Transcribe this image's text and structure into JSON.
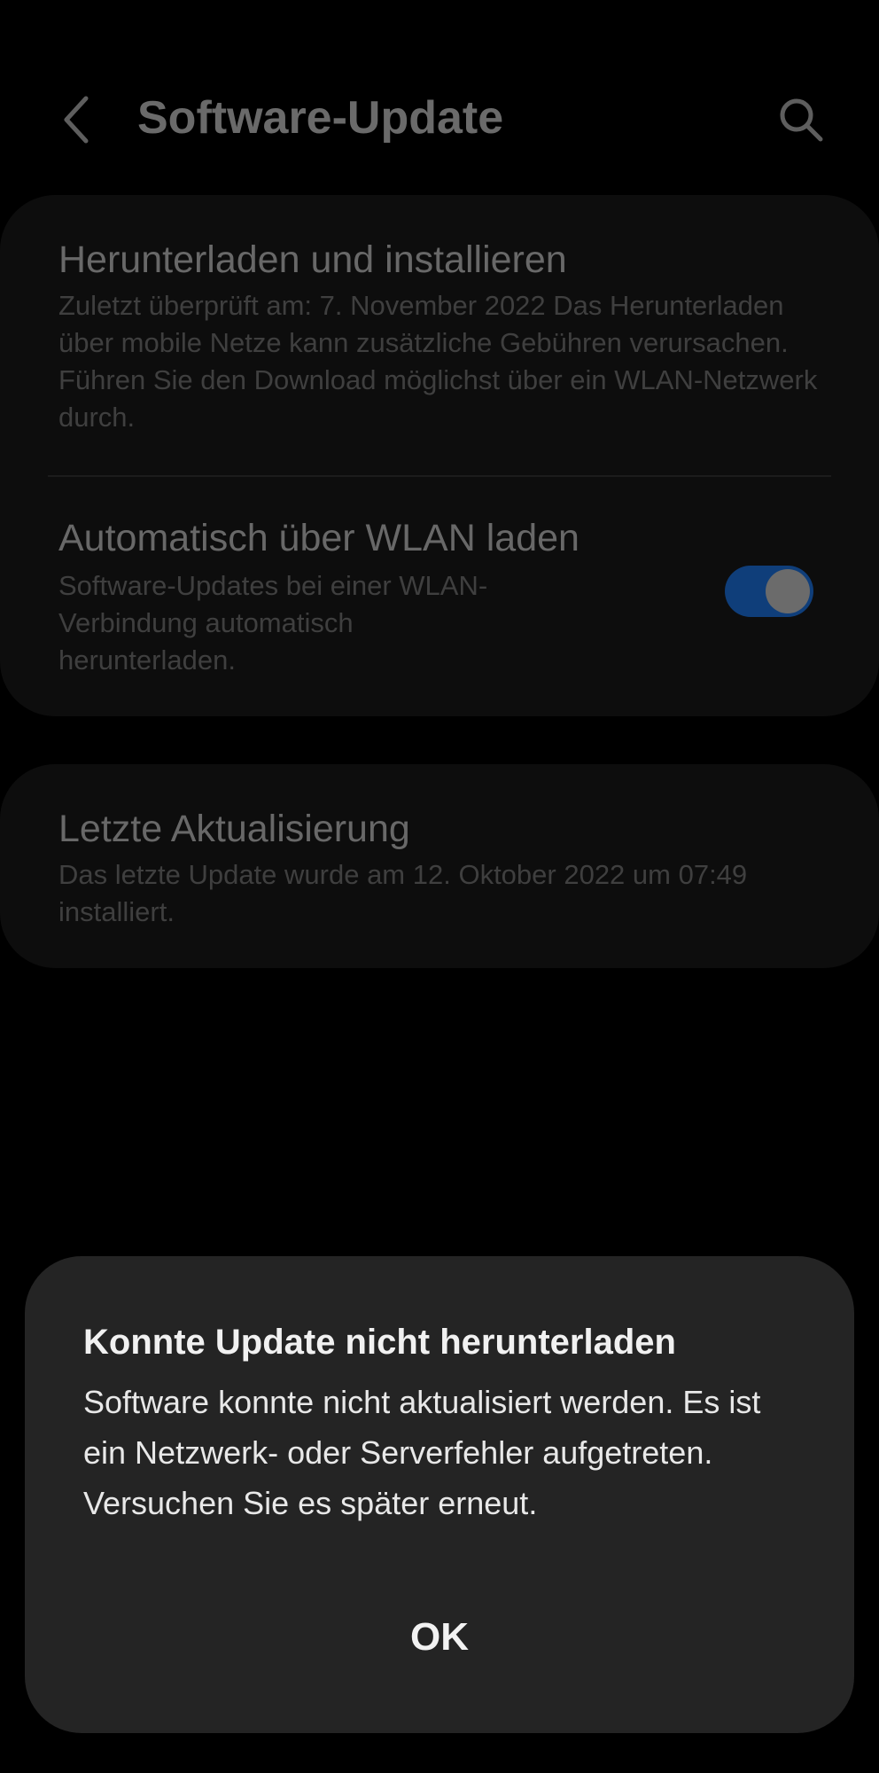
{
  "header": {
    "title": "Software-Update",
    "back_icon": "chevron-left-icon",
    "search_icon": "search-icon"
  },
  "settings": {
    "download_install": {
      "title": "Herunterladen und installieren",
      "subtitle": "Zuletzt überprüft am: 7. November 2022 Das Herunterladen über mobile Netze kann zusätzliche Gebühren verursachen. Führen Sie den Download möglichst über ein WLAN-Netzwerk durch."
    },
    "auto_wifi": {
      "title": "Automatisch über WLAN laden",
      "subtitle": "Software-Updates bei einer WLAN-Verbindung automatisch herunterladen.",
      "enabled": true
    },
    "last_update": {
      "title": "Letzte Aktualisierung",
      "subtitle": "Das letzte Update wurde am 12. Oktober 2022 um 07:49 installiert."
    }
  },
  "dialog": {
    "title": "Konnte Update nicht herunterladen",
    "message": "Software konnte nicht aktualisiert werden. Es ist ein Netzwerk- oder Serverfehler aufgetreten. Versuchen Sie es später erneut.",
    "ok_label": "OK"
  },
  "colors": {
    "background": "#000000",
    "card": "#0d0d0d",
    "dialog": "#242424",
    "toggle_track": "#0f3e7a"
  }
}
